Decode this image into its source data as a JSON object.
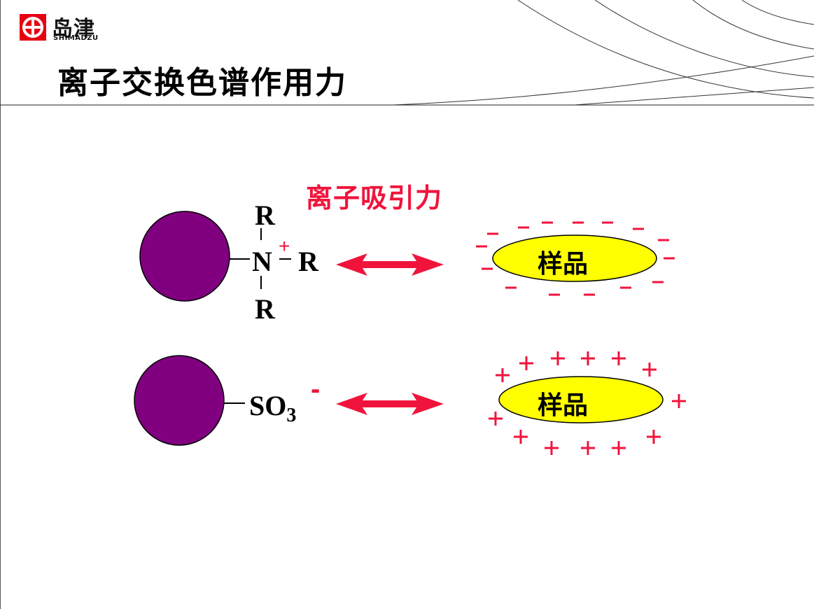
{
  "logo": {
    "cn": "岛津",
    "en": "SHIMADZU"
  },
  "title": "离子交换色谱作用力",
  "subtitle": "离子吸引力",
  "anion_exchanger": {
    "r_top": "R",
    "n": "N",
    "charge": "+",
    "r_right": "R",
    "r_bottom": "R"
  },
  "cation_exchanger": {
    "group": "SO",
    "subscript": "3",
    "charge": "-"
  },
  "sample_label": "样品",
  "colors": {
    "accent": "#f0143c",
    "resin": "#800080",
    "sample": "#ffff00",
    "logo": "#e60012"
  }
}
